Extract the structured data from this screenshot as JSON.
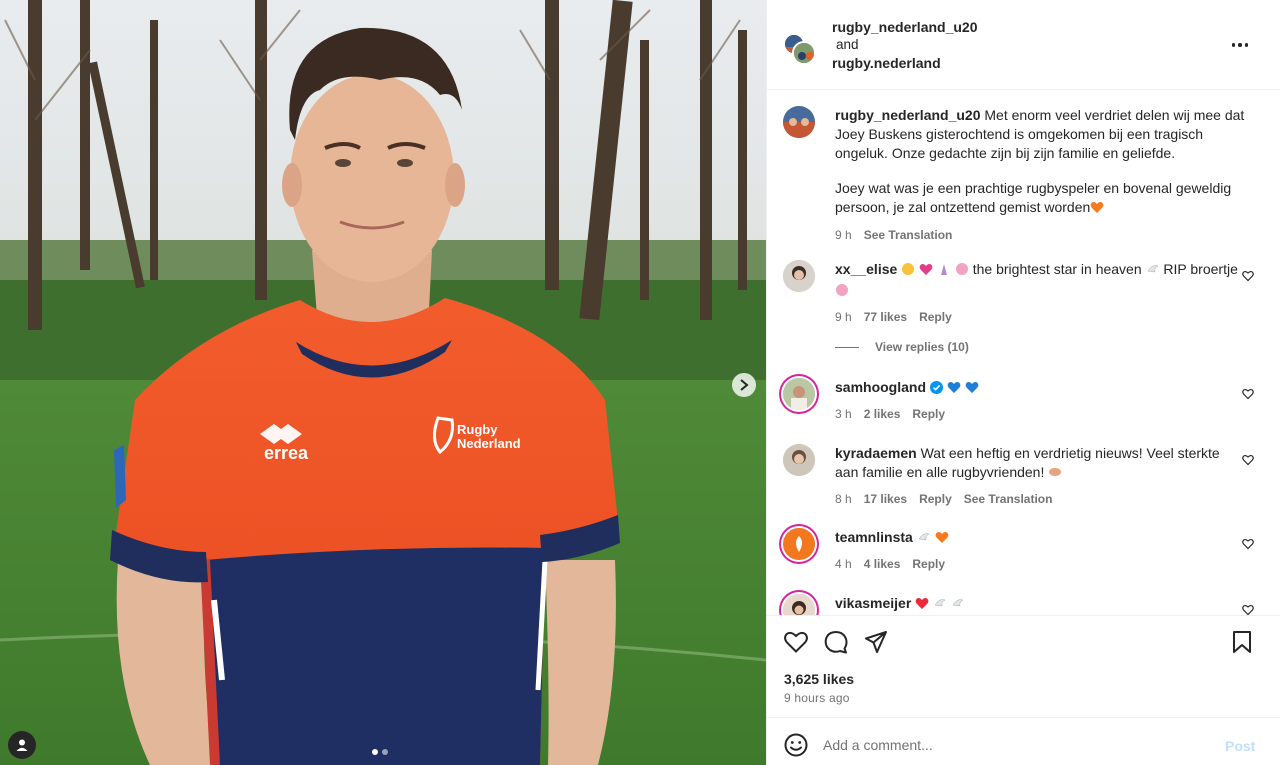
{
  "header": {
    "user1": "rugby_nederland_u20",
    "and": "and",
    "user2": "rugby.nederland",
    "more_icon": "more-options-icon"
  },
  "jersey": {
    "brand": "errea",
    "crest_line1": "Rugby",
    "crest_line2": "Nederland"
  },
  "caption": {
    "username": "rugby_nederland_u20",
    "text1": " Met enorm veel verdriet delen wij mee dat Joey Buskens gisterochtend is omgekomen bij een tragisch ongeluk. Onze gedachte zijn bij zijn familie en geliefde.",
    "text2": "Joey wat was je een prachtige rugbyspeler en bovenal geweldig persoon, je zal ontzettend gemist worden",
    "time": "9 h",
    "see_translation": "See Translation"
  },
  "comments": [
    {
      "username": "xx__elise",
      "text_a": " the brightest star in heaven",
      "text_b": " RIP broertje",
      "time": "9 h",
      "likes": "77 likes",
      "reply": "Reply"
    },
    {
      "username": "samhoogland",
      "time": "3 h",
      "likes": "2 likes",
      "reply": "Reply"
    },
    {
      "username": "kyradaemen",
      "text": " Wat een heftig en verdrietig nieuws! Veel sterkte aan familie en alle rugbyvrienden!",
      "time": "8 h",
      "likes": "17 likes",
      "reply": "Reply",
      "see_translation": "See Translation"
    },
    {
      "username": "teamnlinsta",
      "time": "4 h",
      "likes": "4 likes",
      "reply": "Reply"
    },
    {
      "username": "vikasmeijer"
    }
  ],
  "view_replies": "View replies (10)",
  "footer": {
    "likes": "3,625 likes",
    "time": "9 hours ago",
    "comment_placeholder": "Add a comment...",
    "post": "Post"
  },
  "colors": {
    "brand_blue": "#0095f6",
    "orange_heart": "#f77b1e",
    "blue_heart": "#1f7fd6",
    "red_heart": "#ed2939"
  }
}
